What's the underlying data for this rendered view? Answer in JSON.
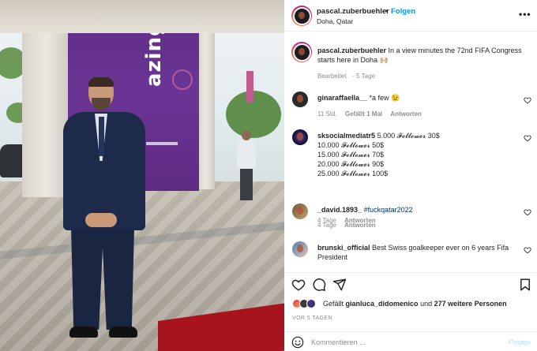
{
  "post": {
    "header": {
      "username": "pascal.zuberbuehler",
      "separator": "•",
      "follow_label": "Folgen",
      "location": "Doha, Qatar",
      "more_label": "•••"
    },
    "caption": {
      "username": "pascal.zuberbuehler",
      "text": "In a view minutes the 72nd FIFA Congress starts here in Doha 🙌🏼",
      "edited": "Bearbeitet",
      "time": "5 Tage"
    },
    "comments": [
      {
        "username": "ginaraffaella__",
        "text": "*a few 😉",
        "time": "11 Std.",
        "likes": "Gefällt 1 Mal",
        "reply": "Antworten"
      },
      {
        "username": "sksocialmediatr5",
        "lines": [
          "5.000 𝓕𝓸𝓵𝓵𝓸𝔀𝓮𝓻 30$",
          "10.000 𝓕𝓸𝓵𝓵𝓸𝔀𝓮𝓻 50$",
          "15.000 𝓕𝓸𝓵𝓵𝓸𝔀𝓮𝓻 70$",
          "20.000 𝓕𝓸𝓵𝓵𝓸𝔀𝓮𝓻 90$",
          "25.000 𝓕𝓸𝓵𝓵𝓸𝔀𝓮𝓻 100$"
        ],
        "time": "4 Tage",
        "reply": "Antworten"
      },
      {
        "username": "_david.1893_",
        "text": "#fuckqatar2022",
        "time": "4 Tage",
        "reply": "Antworten"
      },
      {
        "username": "brunski_official",
        "text": "Best Swiss goalkeeper ever on 6 years Fifa President"
      }
    ],
    "likes": {
      "prefix": "Gefällt",
      "user": "gianluca_didomenico",
      "mid": "und",
      "others": "277 weitere Personen"
    },
    "date": "VOR 5 TAGEN",
    "composer": {
      "placeholder": "Kommentieren ...",
      "post_label": "Posten"
    }
  },
  "icons": {
    "like": "heart-icon",
    "comment": "comment-icon",
    "share": "send-icon",
    "save": "bookmark-icon",
    "emoji": "emoji-icon"
  },
  "colors": {
    "link_blue": "#0095f6",
    "post_disabled": "#b2dffc",
    "muted": "#8e8e8e",
    "text": "#262626"
  }
}
